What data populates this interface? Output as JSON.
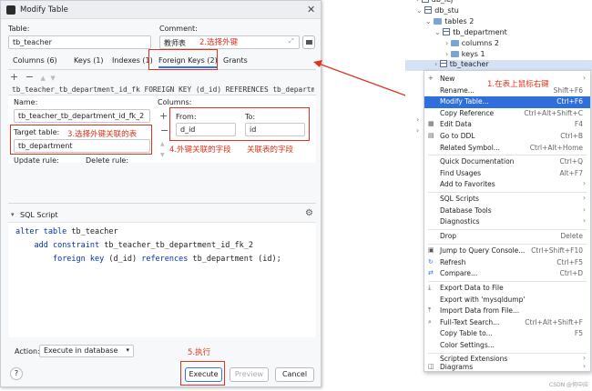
{
  "dialog": {
    "title": "Modify Table",
    "table_label": "Table:",
    "table_value": "tb_teacher",
    "comment_label": "Comment:",
    "comment_value": "教师表",
    "tabs": [
      "Columns (6)",
      "Keys (1)",
      "Indexes (1)",
      "Foreign Keys (2)",
      "Grants"
    ],
    "fk_ddl": "tb_teacher_tb_department_id_fk FOREIGN KEY (d_id) REFERENCES tb_department (",
    "name_label": "Name:",
    "name_value": "tb_teacher_tb_department_id_fk_2",
    "columns_label": "Columns:",
    "from_label": "From:",
    "to_label": "To:",
    "from_value": "d_id",
    "to_value": "id",
    "target_label": "Target table:",
    "target_value": "tb_department",
    "update_label": "Update rule:",
    "delete_label": "Delete rule:",
    "sql_title": "SQL Script",
    "sql_lines": [
      "alter table tb_teacher",
      "    add constraint tb_teacher_tb_department_id_fk_2",
      "        foreign key (d_id) references tb_department (id);"
    ],
    "action_label": "Action:",
    "action_value": "Execute in database",
    "execute": "Execute",
    "preview": "Preview",
    "cancel": "Cancel",
    "help": "?"
  },
  "annotations": {
    "a1": "1.在表上鼠标右键",
    "a2": "2.选择外键",
    "a3": "3.选择外键关联的表",
    "a4a": "4.外键关联的字段",
    "a4b": "关联表的字段",
    "a5": "5.执行"
  },
  "tree": {
    "items": [
      "db_lej",
      "db_stu",
      "tables 2",
      "tb_department",
      "columns 2",
      "keys 1",
      "tb_teacher"
    ]
  },
  "menu": {
    "items": [
      {
        "label": "New",
        "shortcut": ""
      },
      {
        "label": "Rename...",
        "shortcut": "Shift+F6"
      },
      {
        "label": "Modify Table...",
        "shortcut": "Ctrl+F6"
      },
      {
        "label": "Copy Reference",
        "shortcut": "Ctrl+Alt+Shift+C"
      },
      {
        "label": "Edit Data",
        "shortcut": "F4"
      },
      {
        "label": "Go to DDL",
        "shortcut": "Ctrl+B"
      },
      {
        "label": "Related Symbol...",
        "shortcut": "Ctrl+Alt+Home"
      },
      {
        "label": "Quick Documentation",
        "shortcut": "Ctrl+Q"
      },
      {
        "label": "Find Usages",
        "shortcut": "Alt+F7"
      },
      {
        "label": "Add to Favorites",
        "shortcut": ""
      },
      {
        "label": "SQL Scripts",
        "shortcut": ""
      },
      {
        "label": "Database Tools",
        "shortcut": ""
      },
      {
        "label": "Diagnostics",
        "shortcut": ""
      },
      {
        "label": "Drop",
        "shortcut": "Delete"
      },
      {
        "label": "Jump to Query Console...",
        "shortcut": "Ctrl+Shift+F10"
      },
      {
        "label": "Refresh",
        "shortcut": "Ctrl+F5"
      },
      {
        "label": "Compare...",
        "shortcut": "Ctrl+D"
      },
      {
        "label": "Export Data to File",
        "shortcut": ""
      },
      {
        "label": "Export with 'mysqldump'",
        "shortcut": ""
      },
      {
        "label": "Import Data from File...",
        "shortcut": ""
      },
      {
        "label": "Full-Text Search...",
        "shortcut": "Ctrl+Alt+Shift+F"
      },
      {
        "label": "Copy Table to...",
        "shortcut": "F5"
      },
      {
        "label": "Color Settings...",
        "shortcut": ""
      },
      {
        "label": "Scripted Extensions",
        "shortcut": ""
      },
      {
        "label": "Diagrams",
        "shortcut": ""
      }
    ]
  },
  "watermark": "CSDN @何中应"
}
